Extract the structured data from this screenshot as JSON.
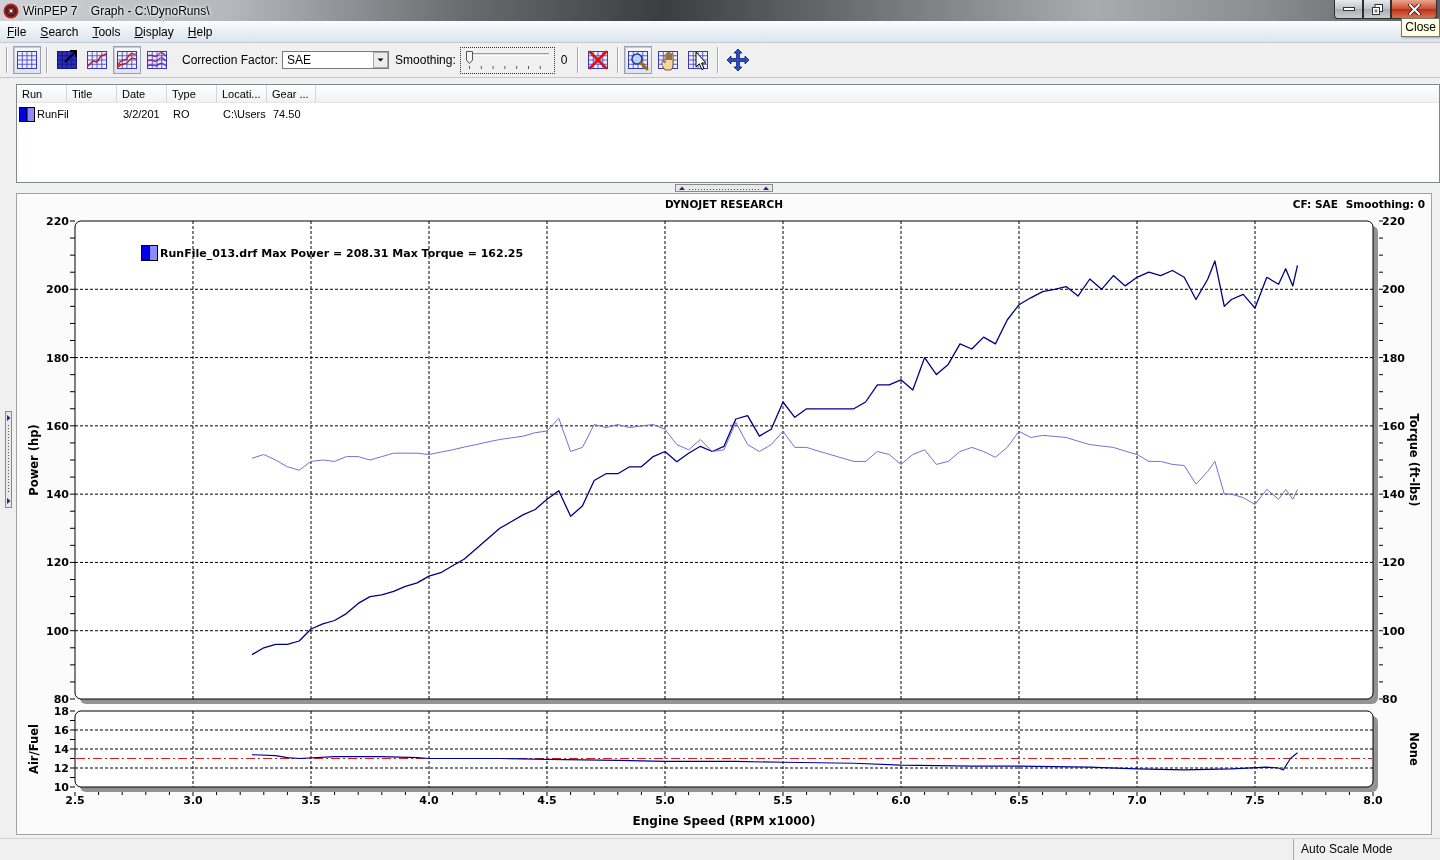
{
  "window": {
    "title": "WinPEP 7    Graph - C:\\DynoRuns\\",
    "tooltip": "Close"
  },
  "menu": [
    "File",
    "Search",
    "Tools",
    "Display",
    "Help"
  ],
  "toolbar": {
    "graph_groups": [
      [
        {
          "kind": "grid",
          "pressed": true
        }
      ],
      [
        {
          "kind": "grid-arrow",
          "pressed": false
        },
        {
          "kind": "grid-line",
          "pressed": false
        },
        {
          "kind": "grid-curves",
          "pressed": true
        },
        {
          "kind": "grid-multi",
          "pressed": false
        }
      ]
    ],
    "correction_factor": {
      "label": "Correction Factor:",
      "value": "SAE"
    },
    "smoothing": {
      "label": "Smoothing:",
      "level": 0,
      "reading": "0"
    },
    "tool_groups": [
      [
        {
          "kind": "clear",
          "pressed": false
        }
      ],
      [
        {
          "kind": "zoom",
          "pressed": true
        },
        {
          "kind": "pan",
          "pressed": false
        },
        {
          "kind": "pointer",
          "pressed": false
        }
      ],
      [
        {
          "kind": "move",
          "pressed": false
        }
      ]
    ]
  },
  "runs": {
    "columns": [
      "Run",
      "Title",
      "Date",
      "Type",
      "Locati...",
      "Gear ..."
    ],
    "rows": [
      {
        "run": "RunFil",
        "date": "3/2/201",
        "type": "RO",
        "location": "C:\\Users",
        "gear": "74.50",
        "selected": false
      }
    ]
  },
  "graph": {
    "info": [
      "CF: SAE",
      "Smoothing: 0"
    ],
    "legend": "RunFile_013.drf Max Power = 208.31 Max Torque = 162.25",
    "main": {
      "chart_data": {
        "type": "line",
        "title": "DYNOJET RESEARCH",
        "ylabel": "Power (hp)",
        "grid": true,
        "xlim": [
          2.5,
          8
        ],
        "ylim": [
          80,
          220
        ],
        "yticks": [
          80,
          100,
          120,
          140,
          160,
          180,
          200,
          220
        ],
        "x": [
          3.25,
          3.3,
          3.35,
          3.4,
          3.45,
          3.5,
          3.55,
          3.6,
          3.65,
          3.7,
          3.75,
          3.8,
          3.85,
          3.9,
          3.95,
          4.0,
          4.05,
          4.1,
          4.15,
          4.2,
          4.25,
          4.3,
          4.35,
          4.4,
          4.45,
          4.5,
          4.55,
          4.6,
          4.65,
          4.7,
          4.75,
          4.8,
          4.85,
          4.9,
          4.95,
          5.0,
          5.05,
          5.1,
          5.15,
          5.2,
          5.25,
          5.3,
          5.35,
          5.4,
          5.45,
          5.5,
          5.55,
          5.6,
          5.65,
          5.7,
          5.75,
          5.8,
          5.85,
          5.9,
          5.95,
          6.0,
          6.05,
          6.1,
          6.15,
          6.2,
          6.25,
          6.3,
          6.35,
          6.4,
          6.45,
          6.5,
          6.55,
          6.6,
          6.65,
          6.7,
          6.75,
          6.8,
          6.85,
          6.9,
          6.95,
          7.0,
          7.05,
          7.1,
          7.15,
          7.2,
          7.25,
          7.3,
          7.33,
          7.37,
          7.4,
          7.45,
          7.5,
          7.55,
          7.6,
          7.63,
          7.66,
          7.68
        ],
        "series": [
          {
            "color": "#000080",
            "values": [
              93,
              95,
              96,
              96,
              97,
              100.5,
              102,
              103,
              105,
              108,
              110,
              110.5,
              111.5,
              113,
              114,
              116,
              117,
              119,
              121,
              124,
              127,
              130,
              132,
              134,
              135.5,
              138.5,
              141,
              133.5,
              136.5,
              144,
              146,
              146,
              148,
              148,
              151,
              152.5,
              149.5,
              152,
              154,
              152.5,
              154,
              162,
              163,
              157,
              159,
              167,
              162.5,
              165,
              165,
              165,
              165,
              165,
              167,
              172,
              172,
              173.5,
              170.5,
              180,
              175,
              178,
              184,
              182.5,
              186,
              184,
              191,
              195.5,
              197.5,
              199.3,
              200,
              200.8,
              198,
              203,
              200,
              204,
              201,
              203.5,
              205,
              204,
              205.5,
              203.5,
              197,
              203,
              208.3,
              195,
              197,
              198.5,
              194.5,
              203.5,
              201.5,
              206,
              201,
              207
            ]
          },
          {
            "color": "#7272d2",
            "values": [
              150.5,
              151.6,
              150,
              148,
              147,
              149.6,
              150,
              149.6,
              151,
              151,
              150,
              151,
              152,
              152,
              152,
              151.6,
              152.3,
              153,
              153.8,
              154.5,
              155.3,
              156,
              156.5,
              157,
              158,
              158.5,
              162.2,
              152.5,
              153.7,
              160.4,
              159.5,
              160.4,
              159.5,
              160,
              160.4,
              159,
              154.5,
              153,
              156,
              152.5,
              153,
              161,
              154.5,
              152.5,
              154.5,
              158.4,
              153.7,
              153.7,
              152.6,
              151.6,
              150.6,
              149.6,
              149.6,
              152.5,
              151.6,
              148.7,
              151.6,
              153,
              148.7,
              149.6,
              152.5,
              153.7,
              152.5,
              150.8,
              153.7,
              158.4,
              156.6,
              157.2,
              156.9,
              156.6,
              155.5,
              154.5,
              154.1,
              153.7,
              152.6,
              151.6,
              149.6,
              149.6,
              148.7,
              148.4,
              142.9,
              146.7,
              149.6,
              140,
              140,
              139,
              137,
              141.4,
              138.5,
              141.4,
              138.5,
              141.4
            ]
          }
        ]
      }
    },
    "torque_axis": {
      "label": "Torque (ft-lbs)",
      "ticks": [
        "220",
        "200",
        "180",
        "160",
        "140",
        "120",
        "100",
        "80"
      ]
    },
    "air_fuel": {
      "right_label": "None",
      "chart_data": {
        "type": "line",
        "xlabel": "Engine Speed (RPM x1000)",
        "ylabel": "Air/Fuel",
        "grid": true,
        "xlim": [
          2.5,
          8
        ],
        "ylim": [
          10,
          18
        ],
        "yticks": [
          10,
          12,
          14,
          16,
          18
        ],
        "xticks": [
          {
            "value": 2.5,
            "label": "2.5"
          },
          {
            "value": 3,
            "label": "3.0"
          },
          {
            "value": 3.5,
            "label": "3.5"
          },
          {
            "value": 4,
            "label": "4.0"
          },
          {
            "value": 4.5,
            "label": "4.5"
          },
          {
            "value": 5,
            "label": "5.0"
          },
          {
            "value": 5.5,
            "label": "5.5"
          },
          {
            "value": 6,
            "label": "6.0"
          },
          {
            "value": 6.5,
            "label": "6.5"
          },
          {
            "value": 7,
            "label": "7.0"
          },
          {
            "value": 7.5,
            "label": "7.5"
          },
          {
            "value": 8,
            "label": "8.0"
          }
        ],
        "x": [
          3.25,
          3.35,
          3.4,
          3.45,
          3.6,
          3.8,
          3.95,
          4.0,
          4.3,
          4.5,
          4.8,
          5.0,
          5.3,
          5.5,
          5.8,
          6.0,
          6.3,
          6.5,
          6.8,
          7.0,
          7.2,
          7.4,
          7.55,
          7.6,
          7.62,
          7.65,
          7.68
        ],
        "series": [
          {
            "color": "#000090",
            "values": [
              13.4,
              13.3,
              13.1,
              13.0,
              13.2,
              13.2,
              13.1,
              13.0,
              13.0,
              12.9,
              12.8,
              12.7,
              12.7,
              12.6,
              12.5,
              12.3,
              12.2,
              12.2,
              12.1,
              11.9,
              11.8,
              11.9,
              12.1,
              12.0,
              11.8,
              13.0,
              13.6
            ]
          }
        ],
        "ref_lines": [
          {
            "axis": "y",
            "value": 13,
            "color": "#d42020"
          }
        ]
      }
    }
  },
  "status_bar": {
    "mode": "Auto Scale Mode"
  }
}
